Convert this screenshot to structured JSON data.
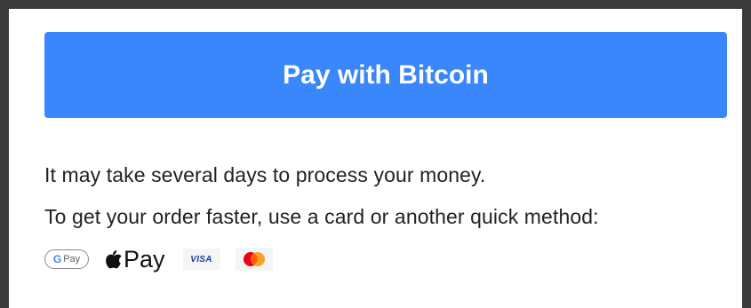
{
  "pay_button": {
    "label": "Pay with Bitcoin",
    "color": "#3987fb"
  },
  "notice": {
    "line1": "It may take several days to process your money.",
    "line2": "To get your order faster, use a card or another quick method:"
  },
  "payment_methods": {
    "gpay": {
      "g": "G",
      "label": "Pay",
      "icon": "google-pay-logo"
    },
    "applepay": {
      "label": "Pay",
      "icon": "apple-pay-logo"
    },
    "visa": {
      "label": "VISA",
      "icon": "visa-logo"
    },
    "mastercard": {
      "icon": "mastercard-logo",
      "colors": [
        "#eb001b",
        "#f79e1b"
      ]
    }
  }
}
